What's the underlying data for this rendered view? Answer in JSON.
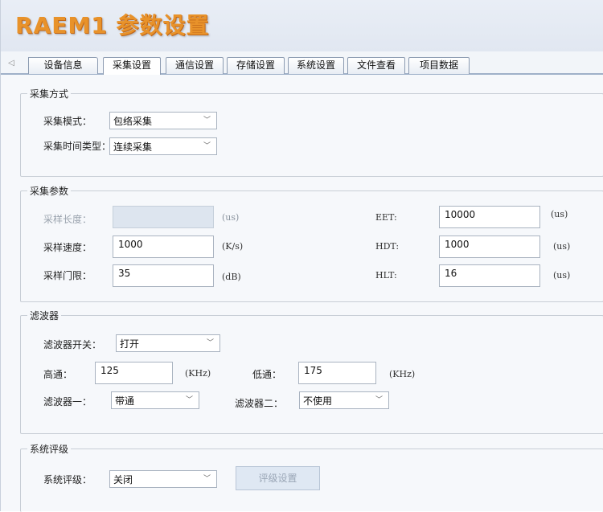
{
  "app": {
    "title": "RAEM1 参数设置"
  },
  "tabs": [
    {
      "label": "设备信息"
    },
    {
      "label": "采集设置"
    },
    {
      "label": "通信设置"
    },
    {
      "label": "存储设置"
    },
    {
      "label": "系统设置"
    },
    {
      "label": "文件查看"
    },
    {
      "label": "项目数据"
    }
  ],
  "tab_scroll_icon": "triangle-left-icon",
  "acquisition_mode": {
    "legend": "采集方式",
    "mode_label": "采集模式：",
    "mode_value": "包络采集",
    "time_type_label": "采集时间类型：",
    "time_type_value": "连续采集"
  },
  "acquisition_params": {
    "legend": "采集参数",
    "sample_length_label": "采样长度：",
    "sample_length_value": "",
    "sample_length_unit": "(us)",
    "sample_speed_label": "采样速度：",
    "sample_speed_value": "1000",
    "sample_speed_unit": "(K/s)",
    "sample_threshold_label": "采样门限：",
    "sample_threshold_value": "35",
    "sample_threshold_unit": "(dB)",
    "eet_label": "EET:",
    "eet_value": "10000",
    "eet_unit": "(us)",
    "hdt_label": "HDT:",
    "hdt_value": "1000",
    "hdt_unit": "(us)",
    "hlt_label": "HLT:",
    "hlt_value": "16",
    "hlt_unit": "(us)"
  },
  "filter": {
    "legend": "滤波器",
    "switch_label": "滤波器开关：",
    "switch_value": "打开",
    "highpass_label": "高通：",
    "highpass_value": "125",
    "highpass_unit": "(KHz)",
    "lowpass_label": "低通：",
    "lowpass_value": "175",
    "lowpass_unit": "(KHz)",
    "filter1_label": "滤波器一：",
    "filter1_value": "带通",
    "filter2_label": "滤波器二：",
    "filter2_value": "不使用"
  },
  "system_rating": {
    "legend": "系统评级",
    "rating_label": "系统评级：",
    "rating_value": "关闭",
    "rating_settings_button": "评级设置"
  }
}
